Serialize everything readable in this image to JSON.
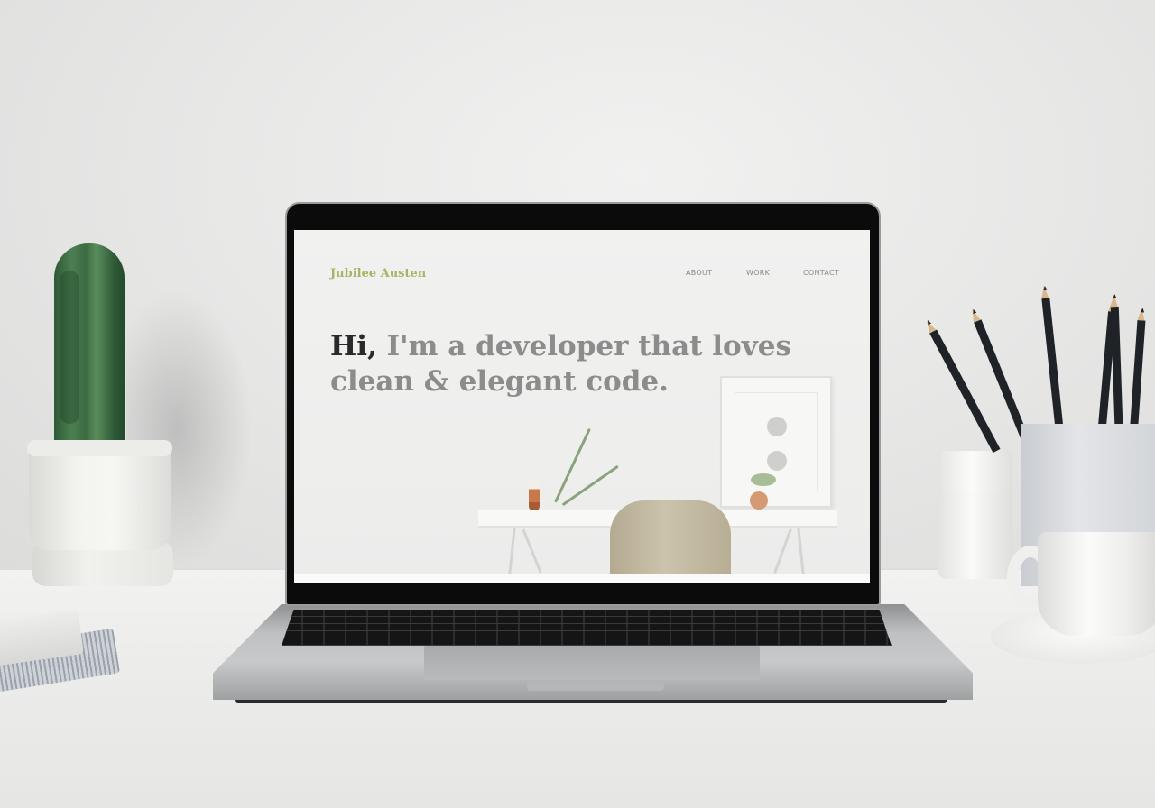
{
  "scene": {
    "description_free": true
  },
  "website": {
    "logo": "Jubilee Austen",
    "nav": [
      {
        "label": "ABOUT"
      },
      {
        "label": "WORK"
      },
      {
        "label": "CONTACT"
      }
    ],
    "hero": {
      "greeting": "Hi,",
      "line1_rest": " I'm a developer that loves",
      "line2": "clean & elegant code."
    },
    "colors": {
      "logo": "#a7b463",
      "greeting": "#2a2a2a",
      "hero_text": "#8c8c8c",
      "nav_text": "#8a8a8a"
    }
  }
}
